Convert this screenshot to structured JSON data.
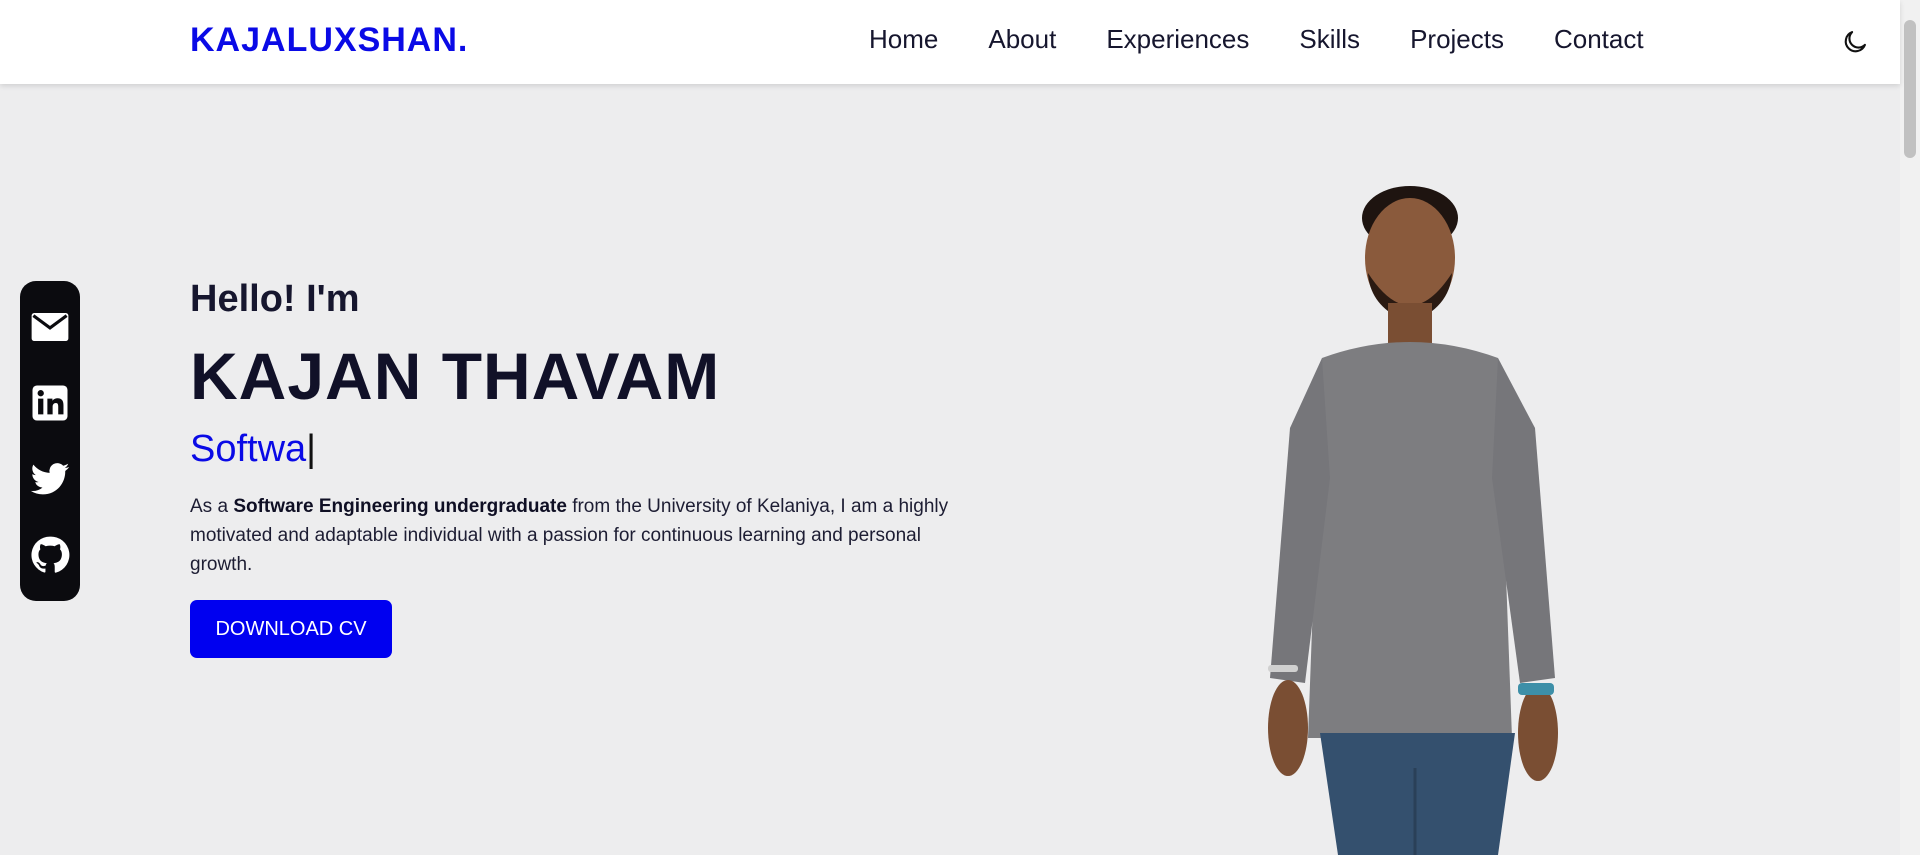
{
  "header": {
    "brand": "KAJALUXSHAN.",
    "nav": [
      {
        "label": "Home"
      },
      {
        "label": "About"
      },
      {
        "label": "Experiences"
      },
      {
        "label": "Skills"
      },
      {
        "label": "Projects"
      },
      {
        "label": "Contact"
      }
    ],
    "theme_toggle_icon": "moon-icon"
  },
  "social": [
    {
      "icon": "mail-icon"
    },
    {
      "icon": "linkedin-icon"
    },
    {
      "icon": "twitter-icon"
    },
    {
      "icon": "github-icon"
    }
  ],
  "hero": {
    "greeting": "Hello! I'm",
    "name": "KAJAN THAVAM",
    "typed_text": "Softwa",
    "caret": "|",
    "intro": {
      "prefix": "As a ",
      "emphasis": "Software Engineering undergraduate",
      "suffix": " from the University of Kelaniya, I am a highly motivated and adaptable individual with a passion for continuous learning and personal growth."
    },
    "cv_button": "DOWNLOAD CV"
  },
  "colors": {
    "accent": "#0a0ae6",
    "button": "#0000f0",
    "background": "#ededee",
    "rail": "#0b0b0f"
  }
}
